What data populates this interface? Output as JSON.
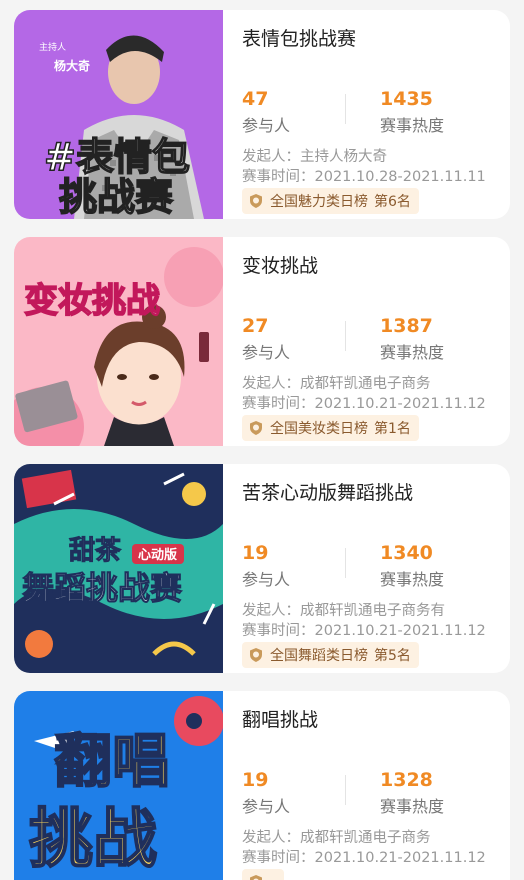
{
  "cards": [
    {
      "title": "表情包挑战赛",
      "participants": "47",
      "participants_label": "参与人",
      "heat": "1435",
      "heat_label": "赛事热度",
      "organizer_label": "发起人：",
      "organizer": "主持人杨大奇",
      "time_label": "赛事时间：",
      "time": "2021.10.28-2021.11.11",
      "rank_category": "全国魅力类日榜",
      "rank_position": "第6名",
      "cover": {
        "line1": "#表情包",
        "line2": "挑战赛",
        "host_label": "主持人",
        "host_name": "杨大奇"
      }
    },
    {
      "title": "变妆挑战",
      "participants": "27",
      "participants_label": "参与人",
      "heat": "1387",
      "heat_label": "赛事热度",
      "organizer_label": "发起人：",
      "organizer": "成都轩凯通电子商务",
      "time_label": "赛事时间：",
      "time": "2021.10.21-2021.11.12",
      "rank_category": "全国美妆类日榜",
      "rank_position": "第1名",
      "cover": {
        "line1": "变妆挑战"
      }
    },
    {
      "title": "苦茶心动版舞蹈挑战",
      "participants": "19",
      "participants_label": "参与人",
      "heat": "1340",
      "heat_label": "赛事热度",
      "organizer_label": "发起人：",
      "organizer": "成都轩凯通电子商务有",
      "time_label": "赛事时间：",
      "time": "2021.10.21-2021.11.12",
      "rank_category": "全国舞蹈类日榜",
      "rank_position": "第5名",
      "cover": {
        "line1": "甜茶",
        "badge": "心动版",
        "line2": "舞蹈挑战赛"
      }
    },
    {
      "title": "翻唱挑战",
      "participants": "19",
      "participants_label": "参与人",
      "heat": "1328",
      "heat_label": "赛事热度",
      "organizer_label": "发起人：",
      "organizer": "成都轩凯通电子商务",
      "time_label": "赛事时间：",
      "time": "2021.10.21-2021.11.12",
      "rank_category": "",
      "rank_position": "",
      "cover": {
        "line1": "翻唱",
        "line2": "挑战"
      }
    }
  ],
  "colors": {
    "accent": "#f08a24",
    "card1_bg": "#b468e6",
    "card2_bg": "#fbb8c6",
    "card3_bg": "#1f2f5c",
    "card4_bg": "#1f7fe8"
  },
  "icons": {
    "rank": "medal-icon"
  }
}
